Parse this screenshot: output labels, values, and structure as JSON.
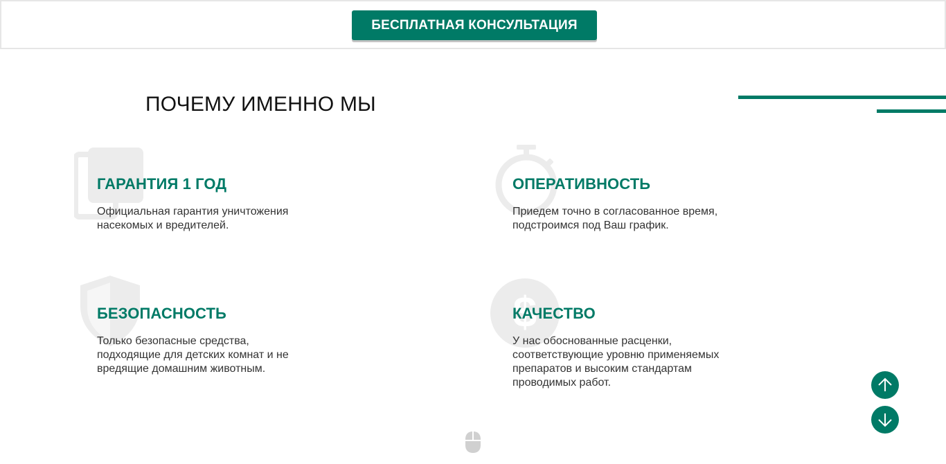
{
  "header": {
    "cta_label": "БЕСПЛАТНАЯ КОНСУЛЬТАЦИЯ"
  },
  "section": {
    "title": "ПОЧЕМУ ИМЕННО МЫ"
  },
  "features": [
    {
      "icon": "document-icon",
      "title": "ГАРАНТИЯ 1 ГОД",
      "text": "Официальная гарантия уничтожения насекомых и вредителей."
    },
    {
      "icon": "stopwatch-icon",
      "title": "ОПЕРАТИВНОСТЬ",
      "text": "Приедем точно в согласованное время, подстроимся под Ваш график."
    },
    {
      "icon": "shield-icon",
      "title": "БЕЗОПАСНОСТЬ",
      "text": "Только безопасные средства, подходящие для детских комнат и не вредящие домашним животным."
    },
    {
      "icon": "dollar-coin-icon",
      "title": "КАЧЕСТВО",
      "text": "У нас обоснованные расценки, соответствующие уровню применяемых препаратов и высоким стандартам проводимых работ."
    }
  ],
  "controls": {
    "scroll_up_icon": "arrow-up-icon",
    "scroll_down_icon": "arrow-down-icon",
    "scroll_hint_icon": "mouse-icon"
  },
  "colors": {
    "accent": "#007a66",
    "icon_background": "#ececec",
    "text": "#333333",
    "title": "#111111"
  }
}
